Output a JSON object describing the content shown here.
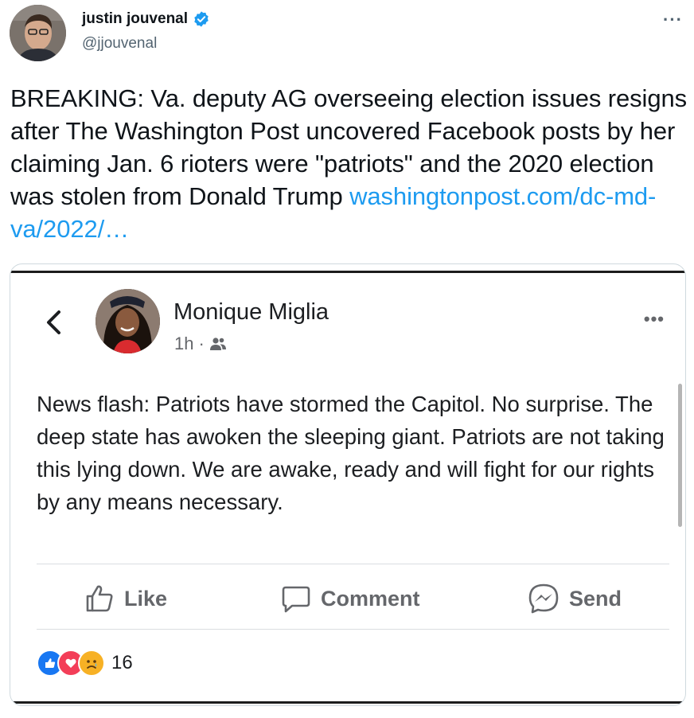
{
  "author": {
    "name": "justin jouvenal",
    "handle": "@jjouvenal",
    "verified": true
  },
  "tweet": {
    "text": "BREAKING: Va. deputy AG overseeing election issues resigns after The Washington Post uncovered Facebook posts by her claiming Jan. 6 rioters were \"patriots\" and the 2020 election was stolen from Donald Trump ",
    "link_text": "washingtonpost.com/dc-md-va/2022/…"
  },
  "embedded_post": {
    "author_name": "Monique Miglia",
    "time": "1h",
    "audience_icon": "friends-icon",
    "body": "News flash: Patriots have stormed the Capitol. No surprise. The deep state has awoken the sleeping giant. Patriots are not taking this lying down. We are awake, ready and will fight for our rights by any means necessary.",
    "actions": [
      {
        "label": "Like",
        "icon": "thumbs-up-icon"
      },
      {
        "label": "Comment",
        "icon": "comment-bubble-icon"
      },
      {
        "label": "Send",
        "icon": "messenger-icon"
      }
    ],
    "reactions": {
      "icons": [
        "like-reaction-icon",
        "love-reaction-icon",
        "sad-reaction-icon"
      ],
      "count": "16"
    }
  },
  "colors": {
    "link": "#1d9bf0",
    "verified": "#1d9bf0",
    "fb_text": "#1c1e21",
    "fb_muted": "#65676b"
  }
}
